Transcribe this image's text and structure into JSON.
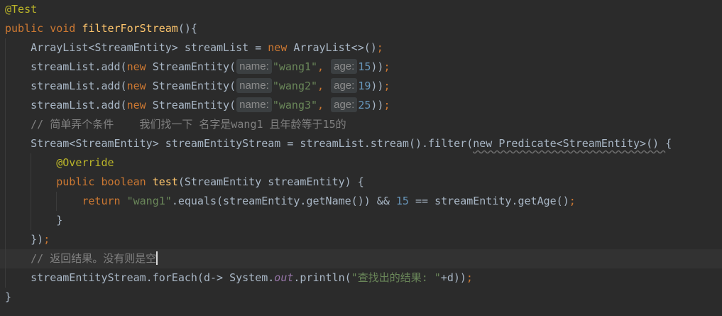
{
  "editor": {
    "lines": [
      [
        {
          "t": "@Test",
          "c": "ann"
        }
      ],
      [
        {
          "t": "public ",
          "c": "kw"
        },
        {
          "t": "void ",
          "c": "kw"
        },
        {
          "t": "filterForStream",
          "c": "fn"
        },
        {
          "t": "(){",
          "c": ""
        }
      ],
      [
        {
          "t": "    ArrayList<StreamEntity> streamList = ",
          "c": ""
        },
        {
          "t": "new ",
          "c": "kw"
        },
        {
          "t": "ArrayList<>()",
          "c": ""
        },
        {
          "t": ";",
          "c": "kw"
        }
      ],
      [
        {
          "t": "    streamList.add(",
          "c": ""
        },
        {
          "t": "new ",
          "c": "kw"
        },
        {
          "t": "StreamEntity(",
          "c": ""
        },
        {
          "t": "name:",
          "c": "hint"
        },
        {
          "t": "\"wang1\"",
          "c": "str"
        },
        {
          "t": ", ",
          "c": "kw"
        },
        {
          "t": "age:",
          "c": "hint"
        },
        {
          "t": "15",
          "c": "num"
        },
        {
          "t": "))",
          "c": ""
        },
        {
          "t": ";",
          "c": "kw"
        }
      ],
      [
        {
          "t": "    streamList.add(",
          "c": ""
        },
        {
          "t": "new ",
          "c": "kw"
        },
        {
          "t": "StreamEntity(",
          "c": ""
        },
        {
          "t": "name:",
          "c": "hint"
        },
        {
          "t": "\"wang2\"",
          "c": "str"
        },
        {
          "t": ", ",
          "c": "kw"
        },
        {
          "t": "age:",
          "c": "hint"
        },
        {
          "t": "19",
          "c": "num"
        },
        {
          "t": "))",
          "c": ""
        },
        {
          "t": ";",
          "c": "kw"
        }
      ],
      [
        {
          "t": "    streamList.add(",
          "c": ""
        },
        {
          "t": "new ",
          "c": "kw"
        },
        {
          "t": "StreamEntity(",
          "c": ""
        },
        {
          "t": "name:",
          "c": "hint"
        },
        {
          "t": "\"wang3\"",
          "c": "str"
        },
        {
          "t": ", ",
          "c": "kw"
        },
        {
          "t": "age:",
          "c": "hint"
        },
        {
          "t": "25",
          "c": "num"
        },
        {
          "t": "))",
          "c": ""
        },
        {
          "t": ";",
          "c": "kw"
        }
      ],
      [
        {
          "t": "    // 简单弄个条件    我们找一下 名字是wang1 且年龄等于15的",
          "c": "cmt"
        }
      ],
      [
        {
          "t": "    Stream<StreamEntity> streamEntityStream = streamList.stream().filter(",
          "c": ""
        },
        {
          "t": "new Predicate<StreamEntity>() ",
          "c": "anon"
        },
        {
          "t": "{",
          "c": ""
        }
      ],
      [
        {
          "t": "        @Override",
          "c": "ann"
        }
      ],
      [
        {
          "t": "        public ",
          "c": "kw"
        },
        {
          "t": "boolean ",
          "c": "kw"
        },
        {
          "t": "test",
          "c": "fn"
        },
        {
          "t": "(StreamEntity streamEntity) {",
          "c": ""
        }
      ],
      [
        {
          "t": "            return ",
          "c": "kw"
        },
        {
          "t": "\"wang1\"",
          "c": "str"
        },
        {
          "t": ".equals(streamEntity.getName()) && ",
          "c": ""
        },
        {
          "t": "15 ",
          "c": "num"
        },
        {
          "t": "== streamEntity.getAge()",
          "c": ""
        },
        {
          "t": ";",
          "c": "kw"
        }
      ],
      [
        {
          "t": "        }",
          "c": ""
        }
      ],
      [
        {
          "t": "    })",
          "c": ""
        },
        {
          "t": ";",
          "c": "kw"
        }
      ],
      [
        {
          "t": "    // 返回结果。没有则是空",
          "c": "cmt"
        },
        {
          "t": "",
          "c": "caret"
        }
      ],
      [
        {
          "t": "    streamEntityStream.forEach(d-> System.",
          "c": ""
        },
        {
          "t": "out",
          "c": "stat"
        },
        {
          "t": ".println(",
          "c": ""
        },
        {
          "t": "\"查找出的结果: \"",
          "c": "str"
        },
        {
          "t": "+d))",
          "c": ""
        },
        {
          "t": ";",
          "c": "kw"
        }
      ],
      [
        {
          "t": "}",
          "c": ""
        }
      ]
    ]
  }
}
